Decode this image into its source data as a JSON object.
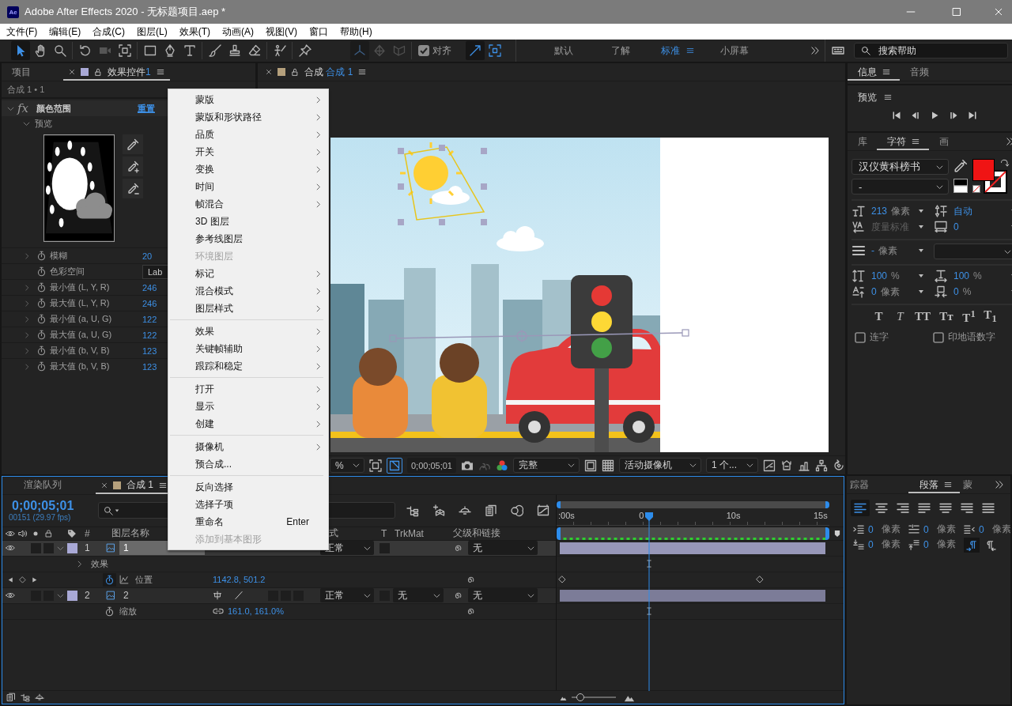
{
  "window": {
    "app_icon": "Ae",
    "title": "Adobe After Effects 2020 - 无标题项目.aep *"
  },
  "menu_bar": [
    "文件(F)",
    "编辑(E)",
    "合成(C)",
    "图层(L)",
    "效果(T)",
    "动画(A)",
    "视图(V)",
    "窗口",
    "帮助(H)"
  ],
  "toolbar": {
    "tools": [
      {
        "selected": true,
        "disabled": false
      },
      {
        "selected": false,
        "disabled": false
      },
      {
        "selected": false,
        "disabled": false
      },
      {
        "selected": false,
        "disabled": false
      },
      {
        "selected": false,
        "disabled": true
      },
      {
        "selected": false,
        "disabled": false
      },
      {
        "selected": false,
        "disabled": false
      },
      {
        "selected": false,
        "disabled": false
      },
      {
        "selected": false,
        "disabled": false
      },
      {
        "selected": false,
        "disabled": false
      },
      {
        "selected": false,
        "disabled": false
      },
      {
        "selected": false,
        "disabled": false
      },
      {
        "selected": false,
        "disabled": false
      },
      {
        "selected": false,
        "disabled": false
      }
    ],
    "axis_modes": [
      {
        "selected": true
      },
      {
        "selected": false
      },
      {
        "selected": false
      }
    ],
    "snapping": {
      "label": "对齐",
      "checked": true
    },
    "snap_options": [
      {
        "on": true
      },
      {
        "on": true
      }
    ],
    "workspaces": [
      {
        "label": "默认",
        "selected": false
      },
      {
        "label": "了解",
        "selected": false
      },
      {
        "label": "标准",
        "selected": true
      },
      {
        "label": "小屏幕",
        "selected": false
      }
    ],
    "search": {
      "placeholder": "搜索帮助"
    }
  },
  "effect_controls": {
    "tabs": [
      {
        "label": "项目",
        "selected": false
      },
      {
        "label": "效果控件",
        "suffix": "1",
        "color": "#a9a9d6",
        "selected": true
      }
    ],
    "header": "合成 1 • 1",
    "effect": {
      "badge": "fx",
      "name": "颜色范围",
      "reset": "重置",
      "expanded": true
    },
    "preview": {
      "label": "预览",
      "expanded": true
    },
    "properties": [
      {
        "kind": "number",
        "label": "模糊",
        "value": "20"
      },
      {
        "kind": "menu",
        "label": "色彩空间",
        "value": "Lab"
      },
      {
        "kind": "number",
        "label": "最小值 (L, Y, R)",
        "value": "246"
      },
      {
        "kind": "number",
        "label": "最大值 (L, Y, R)",
        "value": "246"
      },
      {
        "kind": "number",
        "label": "最小值 (a, U, G)",
        "value": "122"
      },
      {
        "kind": "number",
        "label": "最大值 (a, U, G)",
        "value": "122"
      },
      {
        "kind": "number",
        "label": "最小值 (b, V, B)",
        "value": "123"
      },
      {
        "kind": "number",
        "label": "最大值 (b, V, B)",
        "value": "123"
      }
    ]
  },
  "composition": {
    "tab": {
      "label": "合成",
      "comp": "合成 1",
      "color": "#b5a07c"
    },
    "viewer_bar": {
      "magnification": "%",
      "mask_toggle": {
        "on": true
      },
      "timecode": "0;00;05;01",
      "resolution": "完整",
      "camera": "活动摄像机",
      "views": "1 个..."
    }
  },
  "info_panel": {
    "tabs": [
      {
        "label": "信息",
        "selected": true
      },
      {
        "label": "音频",
        "selected": false
      }
    ]
  },
  "preview_panel": {
    "title": "预览"
  },
  "character": {
    "tabs": [
      {
        "label": "库",
        "selected": false
      },
      {
        "label": "字符",
        "selected": true
      },
      {
        "label": "画",
        "selected": false
      }
    ],
    "font": "汉仪黄科榜书",
    "style": "-",
    "color_swatches": [
      {
        "kind": "stroke",
        "color": "#ffffff"
      },
      {
        "kind": "fill",
        "color": "#f01414"
      }
    ],
    "size": {
      "value": "213",
      "unit": "像素"
    },
    "leading": {
      "value": "自动"
    },
    "kerning": {
      "value": "度量标准",
      "disabled": true
    },
    "tracking": {
      "value": "0"
    },
    "stroke_width": {
      "value": "-",
      "unit": "像素"
    },
    "vertical_scale": {
      "value": "100",
      "unit": "%"
    },
    "horizontal_scale": {
      "value": "100",
      "unit": "%"
    },
    "baseline_shift": {
      "value": "0",
      "unit": "像素"
    },
    "tsume": {
      "value": "0",
      "unit": "%"
    },
    "style_buttons": [
      {
        "kind": "bold",
        "label": "T"
      },
      {
        "kind": "italic",
        "label": "T"
      },
      {
        "kind": "caps",
        "label": "TT"
      },
      {
        "kind": "smallcaps",
        "label": "Tᴛ"
      },
      {
        "kind": "superscript",
        "label": "T$^{1}$"
      },
      {
        "kind": "subscript",
        "label": "T$_{1}$"
      }
    ],
    "options": [
      {
        "label": "连字",
        "checked": false
      },
      {
        "label": "印地语数字",
        "checked": false
      }
    ]
  },
  "timeline": {
    "tabs": [
      {
        "label": "渲染队列",
        "selected": false
      },
      {
        "label": "合成 1",
        "color": "#b5a07c",
        "selected": true
      }
    ],
    "timecode": "0;00;05;01",
    "frame_info": "00151 (29.97 fps)",
    "ruler": {
      "labels": [
        ":00s",
        "0",
        "10s",
        "15s"
      ],
      "playhead": {
        "level": 0.333
      }
    },
    "columns": {
      "number": "#",
      "layer_name": "图层名称",
      "mode": "式",
      "preserve_transparency": "T",
      "track_matte": "TrkMat",
      "parent": "父级和链接"
    },
    "layers": [
      {
        "number": "1",
        "name": "1",
        "color": "#a9a9d6",
        "selected": true,
        "visible": true,
        "expanded": true,
        "mode": "正常",
        "parent": "无",
        "children": [
          {
            "kind": "group",
            "label": "效果",
            "expanded": false
          },
          {
            "kind": "property",
            "label": "位置",
            "value": "1142.8, 501.2",
            "animated": true,
            "keyframes": [
              {
                "level": 0
              },
              {
                "level": 0.755
              }
            ]
          }
        ]
      },
      {
        "number": "2",
        "name": "2",
        "color": "#a9a9d6",
        "selected": false,
        "visible": true,
        "expanded": true,
        "mode": "正常",
        "track_matte": "无",
        "parent": "无",
        "switches": [
          {
            "kind": "collapse"
          },
          {
            "kind": "quality"
          }
        ],
        "children": [
          {
            "kind": "property",
            "label": "缩放",
            "value": "161.0, 161.0%",
            "animated": false,
            "linked": true
          }
        ]
      }
    ],
    "zoom_slider": {
      "level": 0.2
    }
  },
  "paragraph": {
    "tabs": [
      {
        "label": "踪器",
        "selected": false
      },
      {
        "label": "段落",
        "selected": true
      },
      {
        "label": "蒙",
        "selected": false
      }
    ],
    "alignment": [
      {
        "selected": true
      },
      {
        "selected": false
      },
      {
        "selected": false
      },
      {
        "selected": false
      },
      {
        "selected": false
      },
      {
        "selected": false
      },
      {
        "selected": false
      }
    ],
    "indents": [
      {
        "value": "0",
        "unit": "像素"
      },
      {
        "value": "0",
        "unit": "像素"
      },
      {
        "value": "0",
        "unit": "像素"
      },
      {
        "value": "0",
        "unit": "像素"
      },
      {
        "value": "0",
        "unit": "像素"
      }
    ],
    "direction": [
      {
        "selected": true
      },
      {
        "selected": false
      }
    ]
  },
  "context_menu": {
    "groups": [
      [
        {
          "label": "蒙版",
          "submenu": true,
          "disabled": false
        },
        {
          "label": "蒙版和形状路径",
          "submenu": true,
          "disabled": false
        },
        {
          "label": "品质",
          "submenu": true,
          "disabled": false
        },
        {
          "label": "开关",
          "submenu": true,
          "disabled": false
        },
        {
          "label": "变换",
          "submenu": true,
          "disabled": false
        },
        {
          "label": "时间",
          "submenu": true,
          "disabled": false
        },
        {
          "label": "帧混合",
          "submenu": true,
          "disabled": false
        },
        {
          "label": "3D 图层",
          "submenu": false,
          "disabled": false
        },
        {
          "label": "参考线图层",
          "submenu": false,
          "disabled": false
        },
        {
          "label": "环境图层",
          "submenu": false,
          "disabled": true
        },
        {
          "label": "标记",
          "submenu": true,
          "disabled": false
        },
        {
          "label": "混合模式",
          "submenu": true,
          "disabled": false
        },
        {
          "label": "图层样式",
          "submenu": true,
          "disabled": false
        }
      ],
      [
        {
          "label": "效果",
          "submenu": true,
          "disabled": false
        },
        {
          "label": "关键帧辅助",
          "submenu": true,
          "disabled": false
        },
        {
          "label": "跟踪和稳定",
          "submenu": true,
          "disabled": false
        }
      ],
      [
        {
          "label": "打开",
          "submenu": true,
          "disabled": false
        },
        {
          "label": "显示",
          "submenu": true,
          "disabled": false
        },
        {
          "label": "创建",
          "submenu": true,
          "disabled": false
        }
      ],
      [
        {
          "label": "摄像机",
          "submenu": true,
          "disabled": false
        },
        {
          "label": "预合成...",
          "submenu": false,
          "disabled": false
        }
      ],
      [
        {
          "label": "反向选择",
          "submenu": false,
          "disabled": false
        },
        {
          "label": "选择子项",
          "submenu": false,
          "disabled": false
        },
        {
          "label": "重命名",
          "shortcut": "Enter",
          "submenu": false,
          "disabled": false
        },
        {
          "label": "添加到基本图形",
          "submenu": false,
          "disabled": true
        }
      ]
    ]
  }
}
